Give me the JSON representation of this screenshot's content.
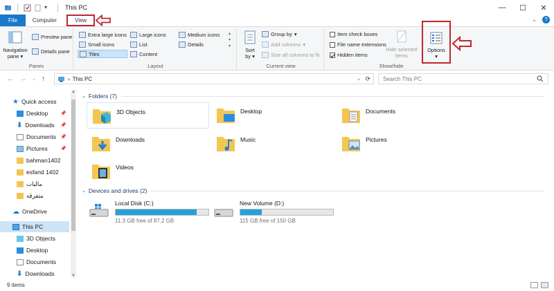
{
  "window": {
    "title": "This PC"
  },
  "tabs": {
    "file": "File",
    "computer": "Computer",
    "view": "View"
  },
  "ribbon": {
    "panes": {
      "label": "Panes",
      "navigation_pane": "Navigation pane",
      "navigation_pane_line1": "Navigation",
      "navigation_pane_line2": "pane",
      "preview_pane": "Preview pane",
      "details_pane": "Details pane"
    },
    "layout": {
      "label": "Layout",
      "extra_large_icons": "Extra large icons",
      "large_icons": "Large icons",
      "medium_icons": "Medium icons",
      "small_icons": "Small icons",
      "list": "List",
      "details": "Details",
      "tiles": "Tiles",
      "content": "Content"
    },
    "current_view": {
      "label": "Current view",
      "sort_by_line1": "Sort",
      "sort_by_line2": "by",
      "group_by": "Group by",
      "add_columns": "Add columns",
      "size_all_columns": "Size all columns to fit"
    },
    "show_hide": {
      "label": "Show/hide",
      "item_check_boxes": "Item check boxes",
      "file_name_extensions": "File name extensions",
      "hidden_items": "Hidden items",
      "hide_selected_line1": "Hide selected",
      "hide_selected_line2": "items",
      "options": "Options"
    }
  },
  "address": {
    "path": "This PC",
    "search_placeholder": "Search This PC"
  },
  "nav": {
    "quick_access": "Quick access",
    "items": [
      {
        "label": "Desktop",
        "pinned": true
      },
      {
        "label": "Downloads",
        "pinned": true
      },
      {
        "label": "Documents",
        "pinned": true
      },
      {
        "label": "Pictures",
        "pinned": true
      },
      {
        "label": "bahman1402",
        "pinned": false
      },
      {
        "label": "esfand 1402",
        "pinned": false
      },
      {
        "label": "مالیات",
        "pinned": false
      },
      {
        "label": "متفرقه",
        "pinned": false
      }
    ],
    "onedrive": "OneDrive",
    "this_pc": "This PC",
    "this_pc_children": [
      "3D Objects",
      "Desktop",
      "Documents",
      "Downloads"
    ]
  },
  "content": {
    "folders_header": "Folders (7)",
    "folders": [
      "3D Objects",
      "Desktop",
      "Documents",
      "Downloads",
      "Music",
      "Pictures",
      "Videos"
    ],
    "drives_header": "Devices and drives (2)",
    "drives": [
      {
        "name": "Local Disk (C:)",
        "free": "11.3 GB free of 87.2 GB",
        "used_fraction": 0.87
      },
      {
        "name": "New Volume (D:)",
        "free": "115 GB free of 150 GB",
        "used_fraction": 0.23
      }
    ]
  },
  "status": {
    "items_count": "9 items"
  },
  "colors": {
    "accent": "#1979ca",
    "highlight": "#c0262b",
    "drive_fill": "#26a0da",
    "selection": "#cce4f7"
  }
}
